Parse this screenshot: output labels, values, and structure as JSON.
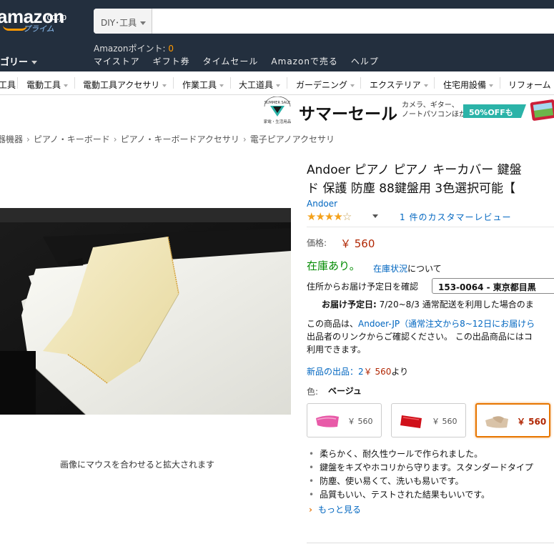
{
  "header": {
    "logo_text": "amazon",
    "logo_tld": ".co.jp",
    "logo_prime": "プライム",
    "search_scope": "DIY･工具",
    "points_label": "Amazonポイント: ",
    "points_value": "0",
    "category_button": "ゴリー",
    "nav": [
      "マイストア",
      "ギフト券",
      "タイムセール",
      "Amazonで売る",
      "ヘルプ"
    ]
  },
  "subnav": {
    "items": [
      "工具",
      "電動工具",
      "電動工具アクセサリ",
      "作業工具",
      "大工道具",
      "ガーデニング",
      "エクステリア",
      "住宅用設備",
      "リフォーム"
    ]
  },
  "banner": {
    "badge_top": "SUMMER SALE",
    "badge_bottom": "家電・生活用品",
    "title": "サマーセール",
    "sub1": "カメラ、ギター、",
    "sub2": "ノートパソコンほか",
    "offer": "50%OFFも"
  },
  "breadcrumb": [
    "器機器",
    "ピアノ・キーボード",
    "ピアノ・キーボードアクセサリ",
    "電子ピアノアクセサリ"
  ],
  "image_hint": "画像にマウスを合わせると拡大されます",
  "product": {
    "title_line1": "Andoer ピアノ ピアノ キーカバー 鍵盤",
    "title_line2": "ド 保護 防塵 88鍵盤用 3色選択可能【",
    "brand": "Andoer",
    "rating": 4,
    "reviews": "1 件のカスタマーレビュー",
    "price_label": "価格:",
    "price": "￥ 560",
    "stock": "在庫あり。",
    "stock_link": "在庫状況",
    "stock_tail": "について",
    "address_label": "住所からお届け予定日を確認",
    "zip": "153-0064 - 東京都目黒",
    "delivery_bold": "お届け予定日:",
    "delivery_text": " 7/20~8/3 通常配送を利用した場合のま",
    "seller_prefix": "この商品は、",
    "seller_link": "Andoer-JP（通常注文から8~12日にお届けら",
    "seller_line2": "出品者のリンクからご確認ください。 この出品商品にはコ",
    "seller_line3": "利用できます。",
    "new_offers_link": "新品の出品：2",
    "new_offers_price": "￥ 560",
    "new_offers_tail": "より",
    "color_label": "色:",
    "color_value": "ベージュ",
    "swatches": [
      {
        "price": "￥ 560",
        "color": "#e85aa8"
      },
      {
        "price": "￥ 560",
        "color": "#d0101a"
      },
      {
        "price": "￥ 560",
        "color": "#d9c3a8"
      }
    ],
    "bullets": [
      "柔らかく、耐久性ウールで作られました。",
      "鍵盤をキズやホコリから守ります。スタンダードタイプ",
      "防塵、使い易くて、洗いも易いです。",
      "品質もいい、テストされた結果もいいです。"
    ],
    "more": "もっと見る"
  },
  "colors": {
    "header_bg": "#232f3e",
    "accent": "#ff9900",
    "link": "#0066c0",
    "price": "#b12704",
    "in_stock": "#008a00"
  }
}
